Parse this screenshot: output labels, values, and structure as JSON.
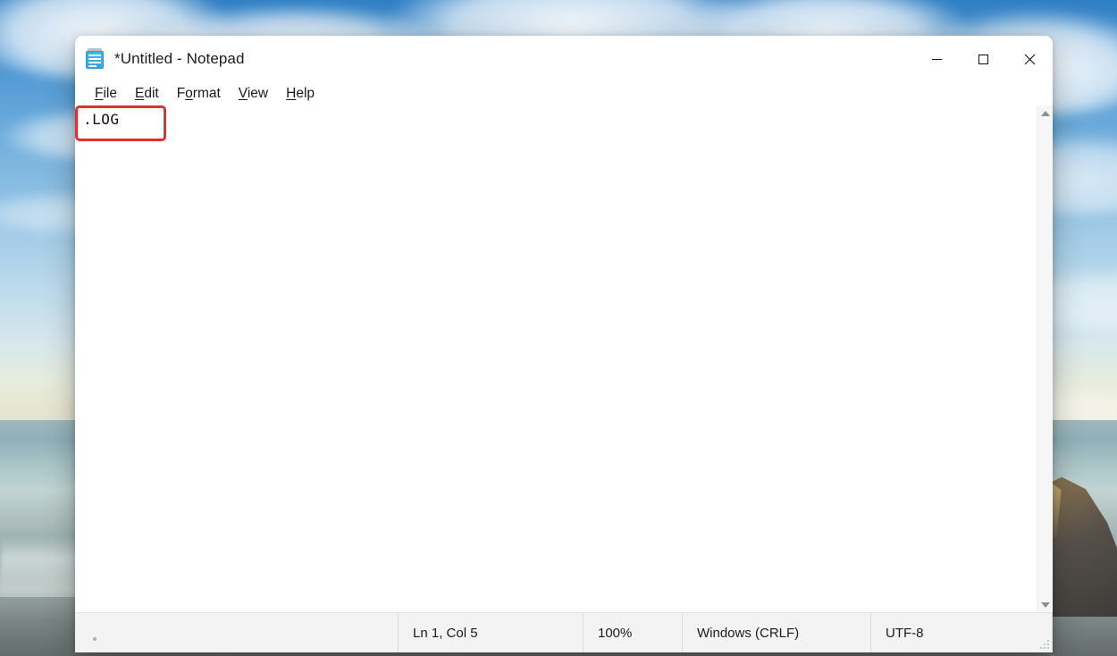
{
  "desktop": {
    "wallpaper_description": "beach-ocean-sea-stack-wallpaper",
    "sky_color": "#4e97d3",
    "sea_color": "#9fb9bd",
    "rock_color": "#55504a"
  },
  "window": {
    "title": "*Untitled - Notepad",
    "icon": "notepad-icon",
    "controls": {
      "minimize": "—",
      "maximize": "☐",
      "close": "✕",
      "minimize_name": "minimize",
      "maximize_name": "maximize",
      "close_name": "close"
    }
  },
  "menubar": {
    "items": [
      {
        "label": "File",
        "accel_index": 0
      },
      {
        "label": "Edit",
        "accel_index": 0
      },
      {
        "label": "Format",
        "accel_index": 1
      },
      {
        "label": "View",
        "accel_index": 0
      },
      {
        "label": "Help",
        "accel_index": 0
      }
    ]
  },
  "editor": {
    "content": ".LOG",
    "annotation": {
      "type": "highlight-rectangle",
      "color": "#e03030",
      "target": ".LOG"
    }
  },
  "scrollbar": {
    "up_arrow": "scroll-up-arrow",
    "down_arrow": "scroll-down-arrow"
  },
  "statusbar": {
    "cursor_position": "Ln 1, Col 5",
    "zoom": "100%",
    "line_ending": "Windows (CRLF)",
    "encoding": "UTF-8"
  }
}
